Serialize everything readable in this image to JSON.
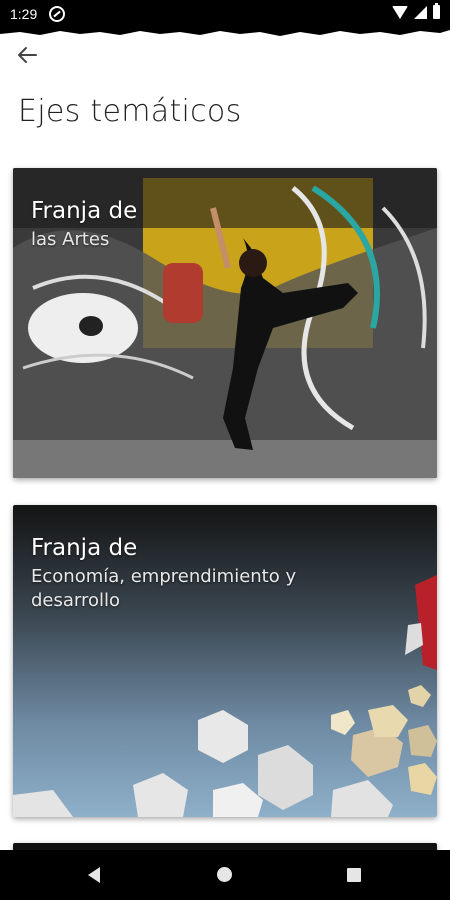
{
  "status_bar": {
    "time": "1:29",
    "icons": [
      "do-not-disturb-icon",
      "wifi-icon",
      "signal-icon",
      "battery-icon"
    ]
  },
  "header": {
    "back_icon": "arrow-left-icon",
    "title": "Ejes temáticos"
  },
  "cards": [
    {
      "heading": "Franja de",
      "subtitle": "las Artes"
    },
    {
      "heading": "Franja de",
      "subtitle": "Economía, emprendimiento y desarrollo"
    }
  ],
  "colors": {
    "status_bar": "#000000",
    "background": "#ffffff",
    "title_text": "#222222",
    "card_text": "#ffffff"
  },
  "nav_bar": {
    "icons": [
      "back-triangle-icon",
      "home-circle-icon",
      "recents-square-icon"
    ]
  }
}
